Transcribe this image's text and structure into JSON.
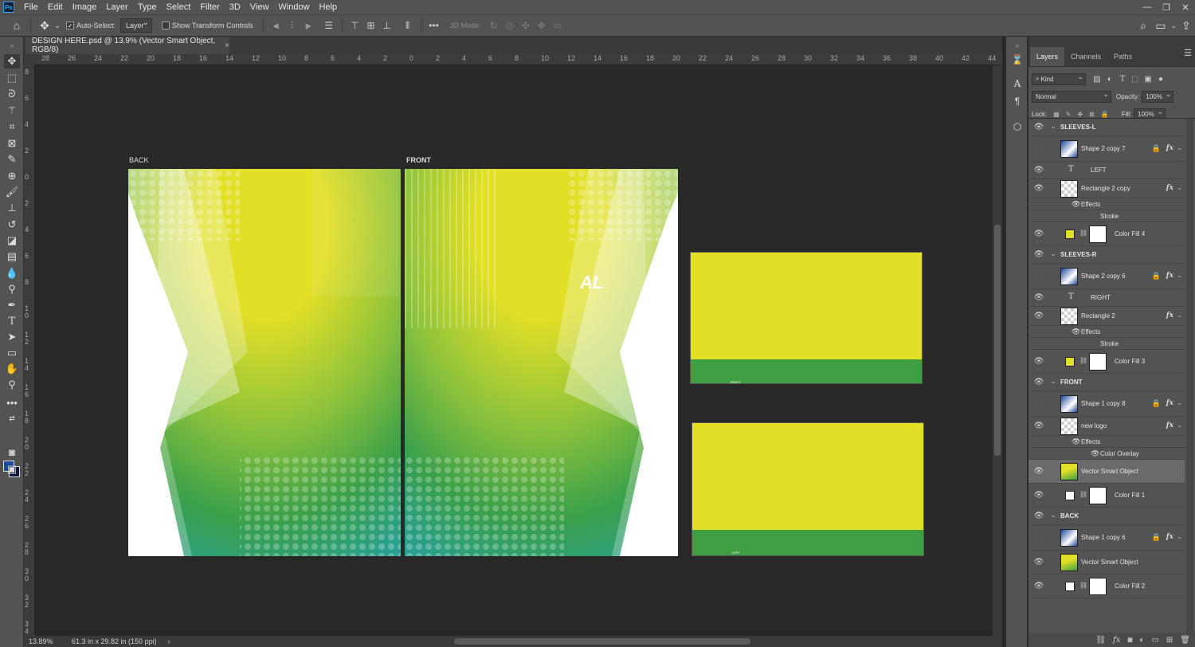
{
  "app": {
    "logo": "Ps"
  },
  "menu": [
    "File",
    "Edit",
    "Image",
    "Layer",
    "Type",
    "Select",
    "Filter",
    "3D",
    "View",
    "Window",
    "Help"
  ],
  "window_controls": {
    "minimize": "—",
    "maximize": "❐",
    "close": "✕"
  },
  "options": {
    "auto_select_label": "Auto-Select:",
    "auto_select_checked": true,
    "auto_select_target": "Layer",
    "show_transform_label": "Show Transform Controls",
    "show_transform_checked": false,
    "mode_3d_label": "3D Mode:",
    "more_label": "•••"
  },
  "document": {
    "tab_title": "DESIGN HERE.psd @ 13.9% (Vector Smart Object, RGB/8)",
    "close": "×",
    "zoom": "13.89%",
    "doc_info": "61.3 in x 29.82 in (150 ppi)"
  },
  "ruler_top": [
    "28",
    "26",
    "24",
    "22",
    "20",
    "18",
    "16",
    "14",
    "12",
    "10",
    "8",
    "6",
    "4",
    "2",
    "0",
    "2",
    "4",
    "6",
    "8",
    "10",
    "12",
    "14",
    "16",
    "18",
    "20",
    "22",
    "24",
    "26",
    "28",
    "30",
    "32",
    "34",
    "36",
    "38",
    "40",
    "42",
    "44"
  ],
  "ruler_left": [
    "8",
    "6",
    "4",
    "2",
    "0",
    "2",
    "4",
    "6",
    "8",
    "1\n0",
    "1\n2",
    "1\n4",
    "1\n6",
    "1\n8",
    "2\n0",
    "2\n2",
    "2\n4",
    "2\n6",
    "2\n8",
    "3\n0",
    "3\n2",
    "3\n4"
  ],
  "artboards": {
    "back_label": "BACK",
    "front_label": "FRONT",
    "logo_text": "AL",
    "sleeve_right_text": "RIGHT",
    "sleeve_left_text": "LEFT"
  },
  "colors": {
    "yellow": "#e2df27",
    "green": "#3f9e42",
    "teal": "#2aa39a",
    "panel": "#535353",
    "selected_layer": "#6a6a6a"
  },
  "panel": {
    "tabs": [
      "Layers",
      "Channels",
      "Paths"
    ],
    "active_tab": "Layers",
    "filter_kind": "Kind",
    "blend_mode": "Normal",
    "opacity_label": "Opacity:",
    "opacity_value": "100%",
    "lock_label": "Lock:",
    "fill_label": "Fill:",
    "fill_value": "100%"
  },
  "layers": [
    {
      "type": "group",
      "name": "SLEEVES-L",
      "visible": true
    },
    {
      "type": "shape",
      "name": "Shape 2 copy 7",
      "visible": false,
      "locked": true,
      "fx": true
    },
    {
      "type": "text",
      "name": "LEFT",
      "visible": true
    },
    {
      "type": "raster",
      "name": "Rectangle 2 copy",
      "visible": true,
      "fx": true
    },
    {
      "type": "effects",
      "name": "Effects"
    },
    {
      "type": "effect",
      "name": "Stroke"
    },
    {
      "type": "fill",
      "name": "Color Fill 4",
      "visible": true,
      "swatch": "#e2df27"
    },
    {
      "type": "group",
      "name": "SLEEVES-R",
      "visible": true
    },
    {
      "type": "shape",
      "name": "Shape 2 copy 6",
      "visible": false,
      "locked": true,
      "fx": true
    },
    {
      "type": "text",
      "name": "RIGHT",
      "visible": true
    },
    {
      "type": "raster",
      "name": "Rectangle 2",
      "visible": true,
      "fx": true
    },
    {
      "type": "effects",
      "name": "Effects"
    },
    {
      "type": "effect",
      "name": "Stroke"
    },
    {
      "type": "fill",
      "name": "Color Fill 3",
      "visible": true,
      "swatch": "#e2df27"
    },
    {
      "type": "group",
      "name": "FRONT",
      "visible": true
    },
    {
      "type": "shape",
      "name": "Shape 1 copy 8",
      "visible": false,
      "locked": true,
      "fx": true
    },
    {
      "type": "raster",
      "name": "new logo",
      "visible": true,
      "fx": true
    },
    {
      "type": "effects",
      "name": "Effects"
    },
    {
      "type": "effect",
      "name": "Color Overlay"
    },
    {
      "type": "smart",
      "name": "Vector Smart Object",
      "visible": true,
      "selected": true
    },
    {
      "type": "fill",
      "name": "Color Fill 1",
      "visible": true,
      "swatch": "#ffffff"
    },
    {
      "type": "group",
      "name": "BACK",
      "visible": true
    },
    {
      "type": "shape",
      "name": "Shape 1 copy 6",
      "visible": false,
      "locked": true,
      "fx": true
    },
    {
      "type": "smart",
      "name": "Vector Smart Object",
      "visible": true
    },
    {
      "type": "fill",
      "name": "Color Fill 2",
      "visible": true,
      "swatch": "#ffffff"
    }
  ]
}
